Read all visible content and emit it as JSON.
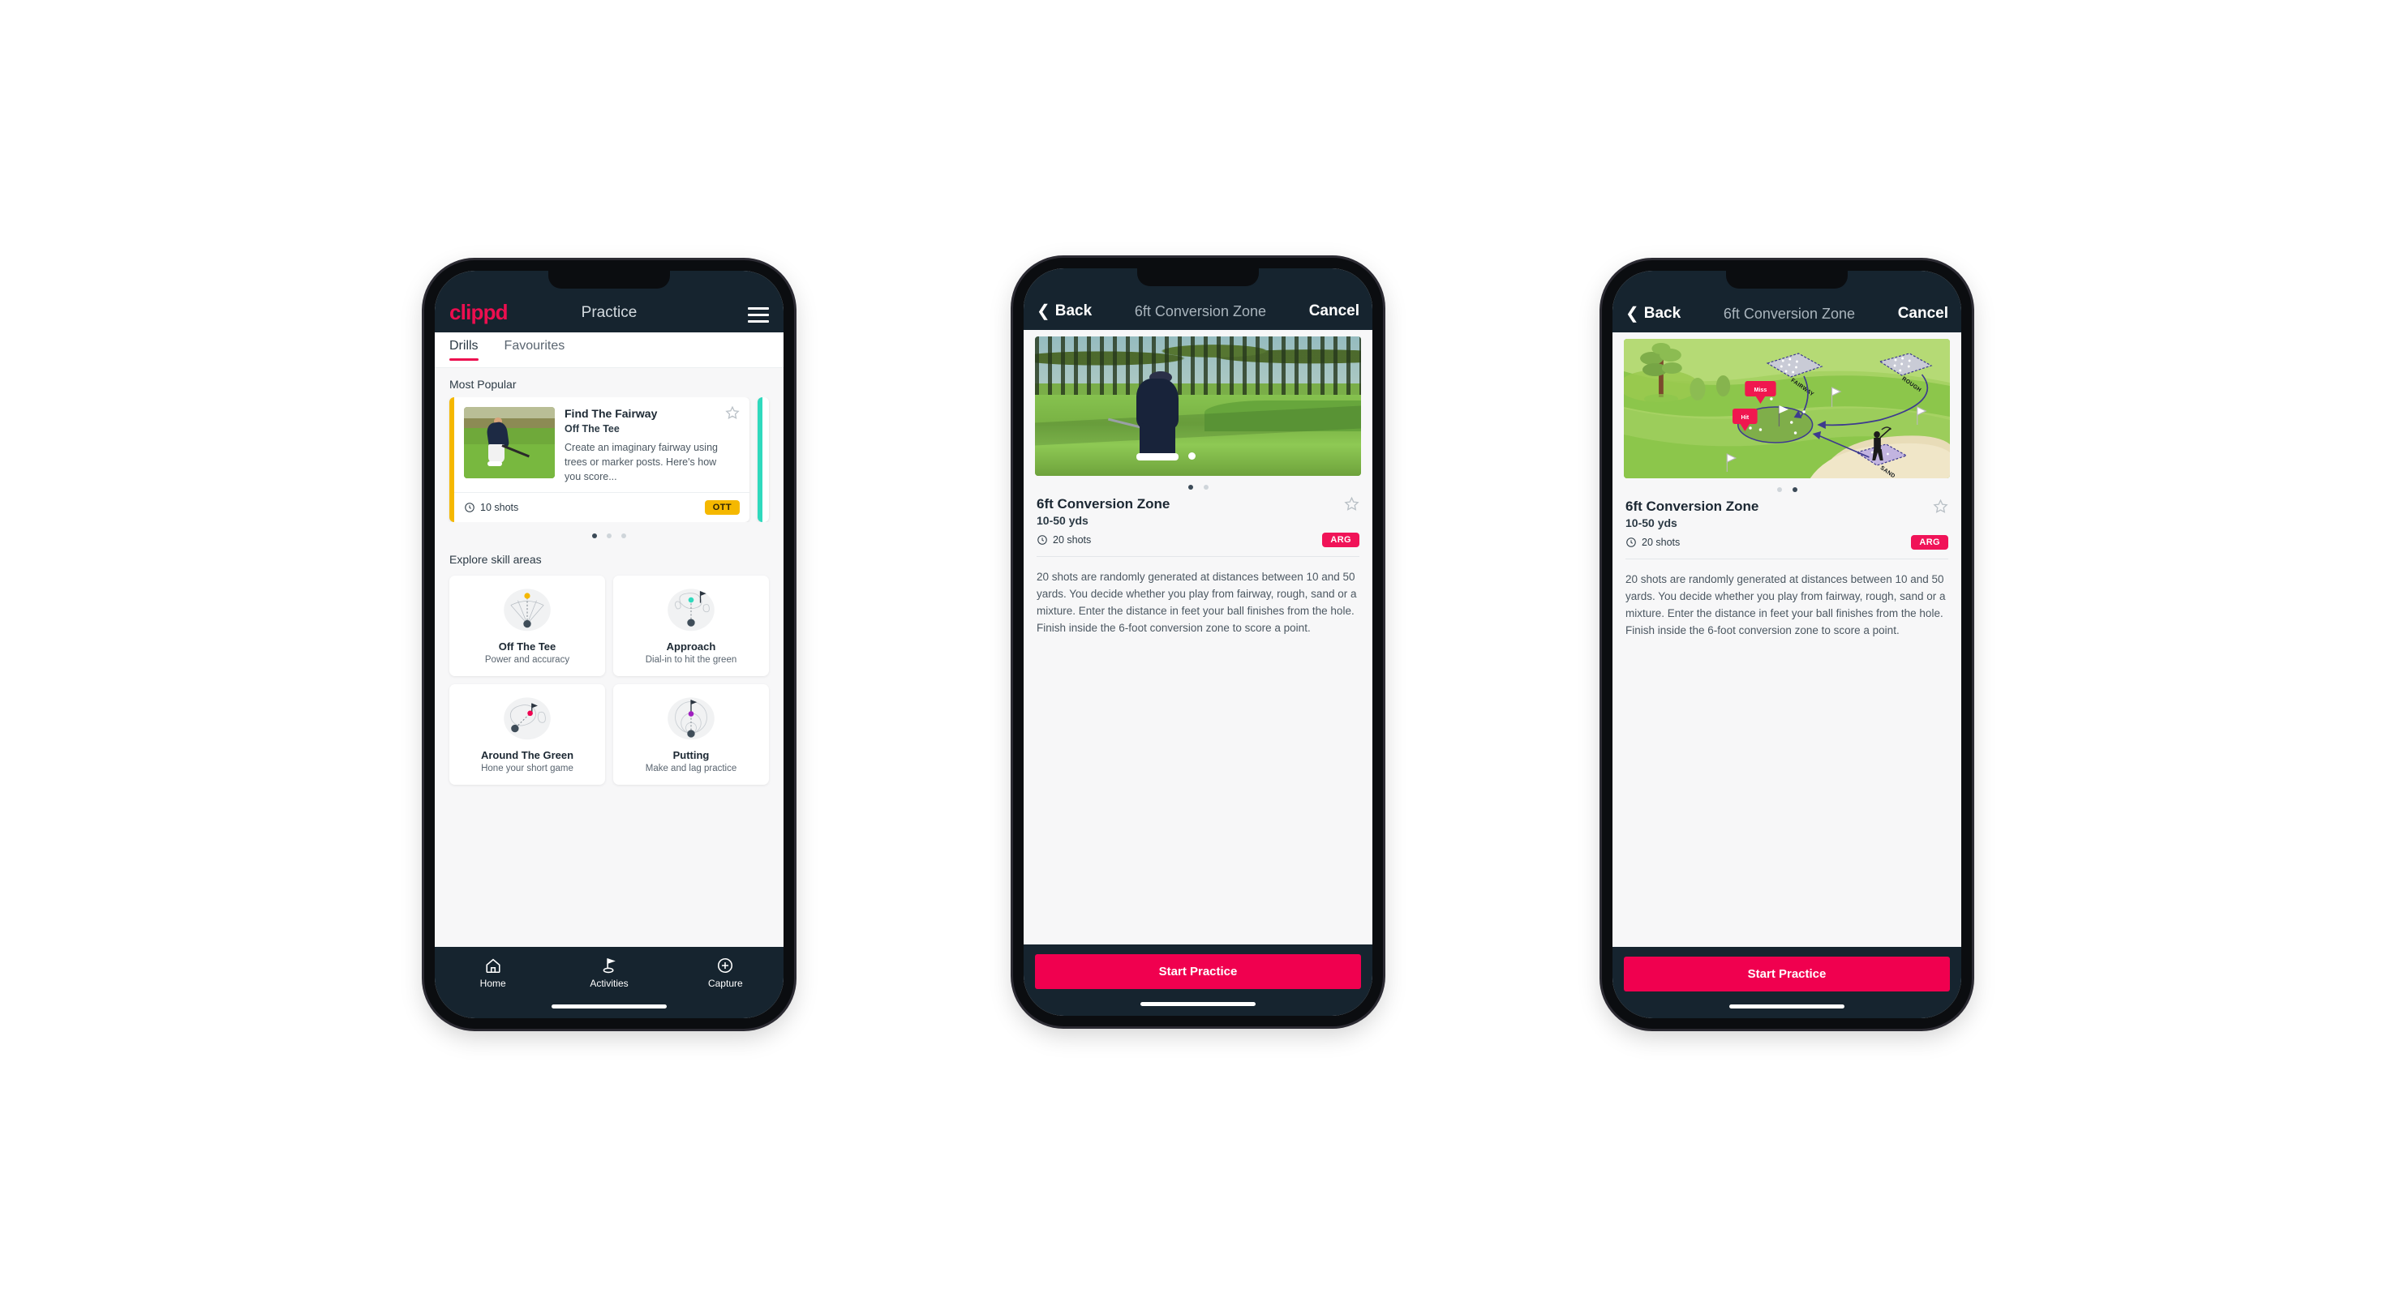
{
  "phone1": {
    "appbar": {
      "logo": "clippd",
      "title": "Practice",
      "menu_icon": "hamburger-icon"
    },
    "tabs": [
      {
        "label": "Drills",
        "active": true
      },
      {
        "label": "Favourites",
        "active": false
      }
    ],
    "sections": {
      "most_popular": "Most Popular",
      "explore": "Explore skill areas"
    },
    "drill_card": {
      "title": "Find The Fairway",
      "subtitle": "Off The Tee",
      "description": "Create an imaginary fairway using trees or marker posts. Here's how you score...",
      "shots": "10 shots",
      "badge": "OTT",
      "badge_color": "#f5b800",
      "accent_color": "#f5b800",
      "next_accent_color": "#2fd9bd",
      "star_icon": "star-outline-icon",
      "clock_icon": "clock-icon"
    },
    "carousel_dots": {
      "count": 3,
      "active": 0
    },
    "skill_areas": [
      {
        "name": "Off The Tee",
        "desc": "Power and accuracy",
        "icon": "tee-fan-icon",
        "dot_color": "#f5b800"
      },
      {
        "name": "Approach",
        "desc": "Dial-in to hit the green",
        "icon": "approach-icon",
        "dot_color": "#2fd9bd"
      },
      {
        "name": "Around The Green",
        "desc": "Hone your short game",
        "icon": "chip-green-icon",
        "dot_color": "#f0004f"
      },
      {
        "name": "Putting",
        "desc": "Make and lag practice",
        "icon": "putting-icon",
        "dot_color": "#a020c0"
      }
    ],
    "bottom_nav": [
      {
        "label": "Home",
        "icon": "home-icon",
        "active": false
      },
      {
        "label": "Activities",
        "icon": "golf-flag-icon",
        "active": true
      },
      {
        "label": "Capture",
        "icon": "plus-circle-icon",
        "active": false
      }
    ]
  },
  "phone2": {
    "navbar": {
      "back": "Back",
      "title": "6ft Conversion Zone",
      "cancel": "Cancel",
      "back_icon": "chevron-left-icon"
    },
    "hero": {
      "type": "photo",
      "alt": "golfer-chipping-photo"
    },
    "dots": {
      "count": 2,
      "active": 0
    },
    "detail": {
      "title": "6ft Conversion Zone",
      "subtitle": "10-50 yds",
      "shots": "20 shots",
      "badge": "ARG",
      "badge_color": "#f01358",
      "star_icon": "star-outline-icon",
      "clock_icon": "clock-icon",
      "description": "20 shots are randomly generated at distances between 10 and 50 yards. You decide whether you play from fairway, rough, sand or a mixture. Enter the distance in feet your ball finishes from the hole. Finish inside the 6-foot conversion zone to score a point."
    },
    "cta": "Start Practice",
    "cta_color": "#f0004f"
  },
  "phone3": {
    "navbar": {
      "back": "Back",
      "title": "6ft Conversion Zone",
      "cancel": "Cancel",
      "back_icon": "chevron-left-icon"
    },
    "hero": {
      "type": "illustration",
      "alt": "golf-course-diagram",
      "labels": {
        "fairway": "FAIRWAY",
        "rough": "ROUGH",
        "sand": "SAND"
      },
      "markers": {
        "miss": "Miss",
        "hit": "Hit"
      }
    },
    "dots": {
      "count": 2,
      "active": 1
    },
    "detail": {
      "title": "6ft Conversion Zone",
      "subtitle": "10-50 yds",
      "shots": "20 shots",
      "badge": "ARG",
      "badge_color": "#f01358",
      "star_icon": "star-outline-icon",
      "clock_icon": "clock-icon",
      "description": "20 shots are randomly generated at distances between 10 and 50 yards. You decide whether you play from fairway, rough, sand or a mixture. Enter the distance in feet your ball finishes from the hole. Finish inside the 6-foot conversion zone to score a point."
    },
    "cta": "Start Practice",
    "cta_color": "#f0004f"
  },
  "theme": {
    "brand_pink": "#ec0e4f",
    "dark_navy": "#16242f",
    "page_bg": "#f7f7f8",
    "amber": "#f5b800",
    "teal": "#2fd9bd"
  }
}
